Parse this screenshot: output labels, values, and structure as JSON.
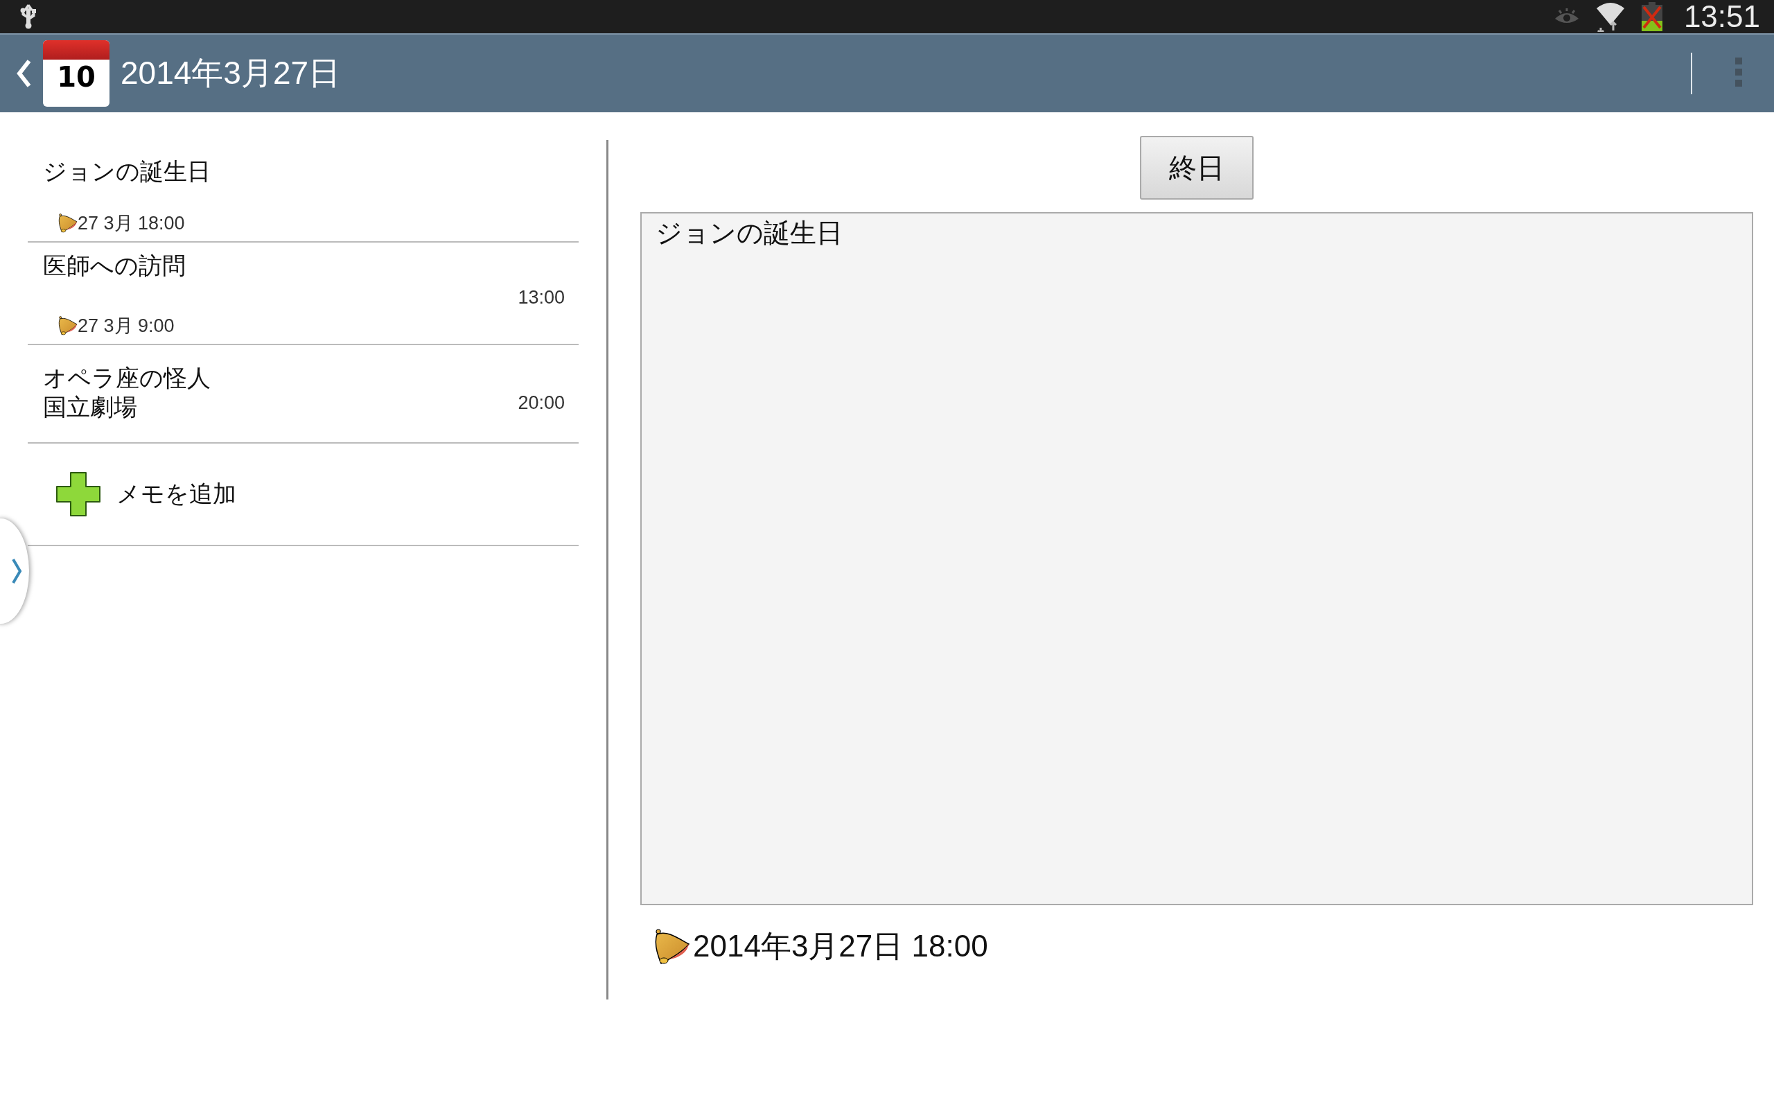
{
  "status_bar": {
    "time": "13:51"
  },
  "header": {
    "calendar_day": "10",
    "title": "2014年3月27日"
  },
  "events": [
    {
      "title": "ジョンの誕生日",
      "alarm": "27 3月 18:00"
    },
    {
      "title": "医師への訪問",
      "time": "13:00",
      "alarm": "27 3月 9:00"
    },
    {
      "title": "オペラ座の怪人",
      "location": "国立劇場",
      "time": "20:00"
    }
  ],
  "add_memo": {
    "label": "メモを追加"
  },
  "detail": {
    "all_day_button": "終日",
    "memo_text": "ジョンの誕生日",
    "alarm": "2014年3月27日 18:00"
  }
}
